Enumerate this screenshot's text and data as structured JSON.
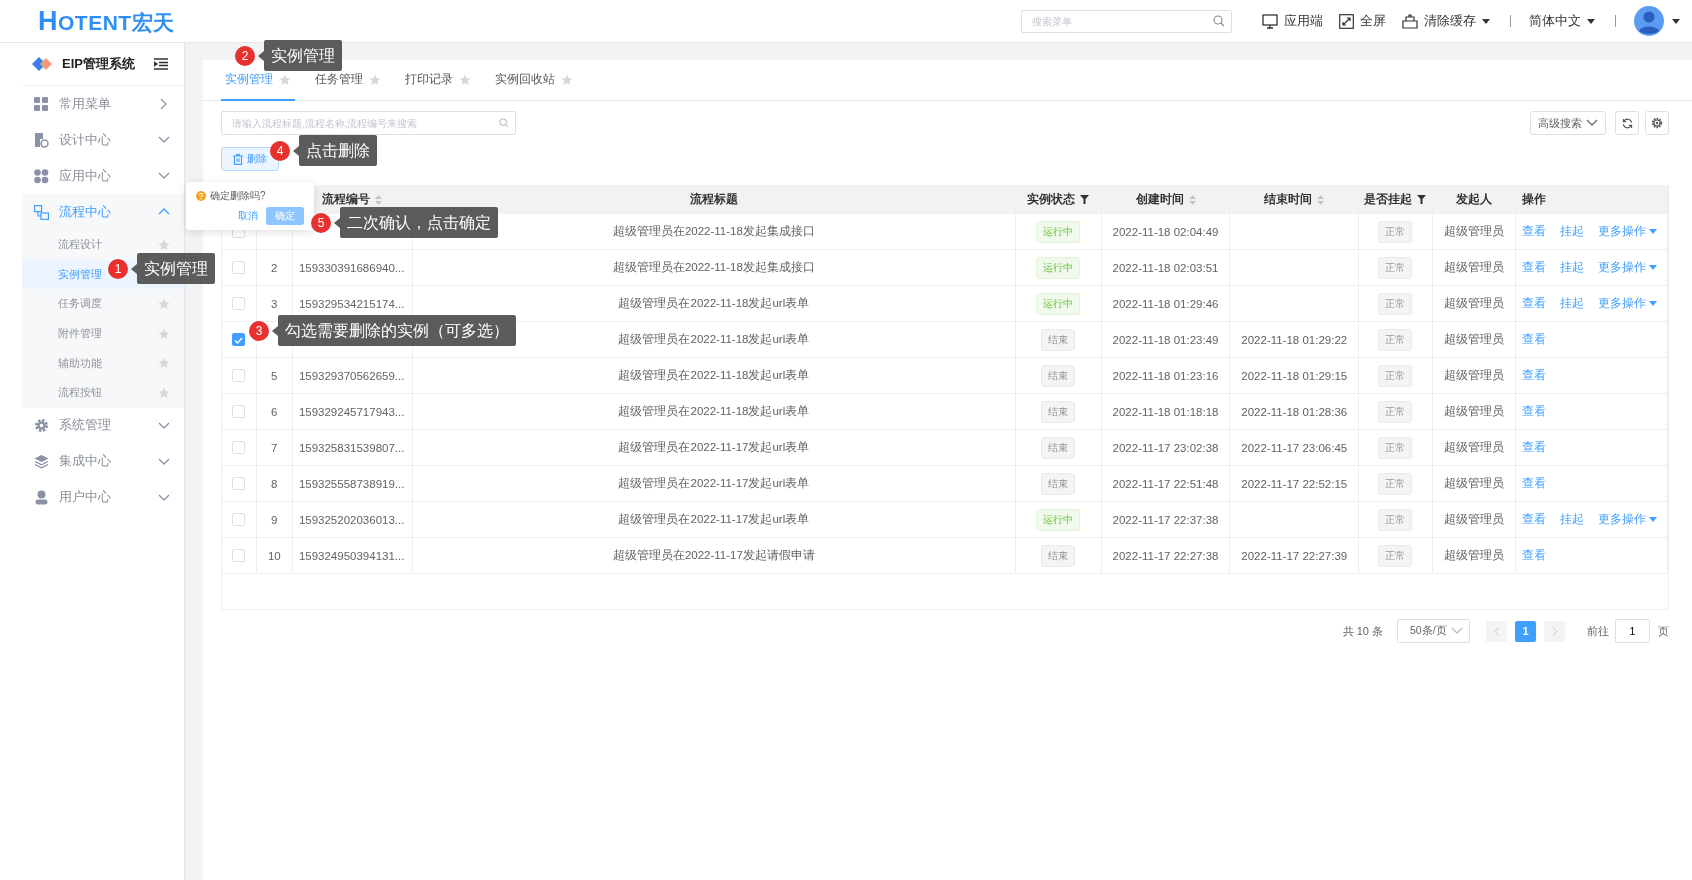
{
  "header": {
    "logo": "HOTENT宏天",
    "search": {
      "placeholder": "搜索菜单"
    },
    "actions": [
      {
        "label": "应用端",
        "dropdown": false
      },
      {
        "label": "全屏",
        "dropdown": false
      },
      {
        "label": "清除缓存",
        "dropdown": true
      }
    ],
    "language": {
      "label": "简体中文"
    }
  },
  "sidebar": {
    "title": "EIP管理系统",
    "items": [
      {
        "label": "常用菜单",
        "kind": "link",
        "selected": false
      },
      {
        "label": "设计中心",
        "kind": "group",
        "expanded": false,
        "selected": false
      },
      {
        "label": "应用中心",
        "kind": "group",
        "expanded": false,
        "selected": false
      },
      {
        "label": "流程中心",
        "kind": "group",
        "expanded": true,
        "selected": true,
        "children": [
          {
            "label": "流程设计",
            "selected": false
          },
          {
            "label": "实例管理",
            "selected": true
          },
          {
            "label": "任务调度",
            "selected": false
          },
          {
            "label": "附件管理",
            "selected": false
          },
          {
            "label": "辅助功能",
            "selected": false
          },
          {
            "label": "流程按钮",
            "selected": false
          }
        ]
      },
      {
        "label": "系统管理",
        "kind": "group",
        "expanded": false,
        "selected": false
      },
      {
        "label": "集成中心",
        "kind": "group",
        "expanded": false,
        "selected": false
      },
      {
        "label": "用户中心",
        "kind": "group",
        "expanded": false,
        "selected": false
      }
    ]
  },
  "tabs": [
    {
      "label": "实例管理",
      "selected": true
    },
    {
      "label": "任务管理",
      "selected": false
    },
    {
      "label": "打印记录",
      "selected": false
    },
    {
      "label": "实例回收站",
      "selected": false
    }
  ],
  "search": {
    "placeholder": "请输入流程标题,流程名称,流程编号来搜索"
  },
  "delete_button": "删除",
  "advanced_search": "高级搜索",
  "table": {
    "columns": [
      {
        "label": "流程编号",
        "sortable": true,
        "filterable": false
      },
      {
        "label": "流程标题",
        "sortable": false,
        "filterable": false
      },
      {
        "label": "实例状态",
        "sortable": false,
        "filterable": true
      },
      {
        "label": "创建时间",
        "sortable": true,
        "filterable": false
      },
      {
        "label": "结束时间",
        "sortable": true,
        "filterable": false
      },
      {
        "label": "是否挂起",
        "sortable": false,
        "filterable": true
      },
      {
        "label": "发起人",
        "sortable": false,
        "filterable": false
      },
      {
        "label": "操作",
        "sortable": false,
        "filterable": false
      }
    ],
    "rows": [
      {
        "checked": false,
        "title": "超级管理员在2022-11-18发起集成接口",
        "status": {
          "label": "运行中",
          "kind": "running"
        },
        "created": "2022-11-18 02:04:49",
        "suspended": "正常",
        "initiator": "超级管理员",
        "actions": [
          "查看",
          "挂起",
          "更多操作"
        ]
      },
      {
        "checked": false,
        "no": "2",
        "id": "159330391686940...",
        "title": "超级管理员在2022-11-18发起集成接口",
        "status": {
          "label": "运行中",
          "kind": "running"
        },
        "created": "2022-11-18 02:03:51",
        "suspended": "正常",
        "initiator": "超级管理员",
        "actions": [
          "查看",
          "挂起",
          "更多操作"
        ]
      },
      {
        "checked": false,
        "no": "3",
        "id": "159329534215174...",
        "title": "超级管理员在2022-11-18发起url表单",
        "status": {
          "label": "运行中",
          "kind": "running"
        },
        "created": "2022-11-18 01:29:46",
        "suspended": "正常",
        "initiator": "超级管理员",
        "actions": [
          "查看",
          "挂起",
          "更多操作"
        ]
      },
      {
        "checked": true,
        "title": "超级管理员在2022-11-18发起url表单",
        "status": {
          "label": "结束",
          "kind": "ended"
        },
        "created": "2022-11-18 01:23:49",
        "ended": "2022-11-18 01:29:22",
        "suspended": "正常",
        "initiator": "超级管理员",
        "actions": [
          "查看"
        ]
      },
      {
        "checked": false,
        "no": "5",
        "id": "159329370562659...",
        "title": "超级管理员在2022-11-18发起url表单",
        "status": {
          "label": "结束",
          "kind": "ended"
        },
        "created": "2022-11-18 01:23:16",
        "ended": "2022-11-18 01:29:15",
        "suspended": "正常",
        "initiator": "超级管理员",
        "actions": [
          "查看"
        ]
      },
      {
        "checked": false,
        "no": "6",
        "id": "159329245717943...",
        "title": "超级管理员在2022-11-18发起url表单",
        "status": {
          "label": "结束",
          "kind": "ended"
        },
        "created": "2022-11-18 01:18:18",
        "ended": "2022-11-18 01:28:36",
        "suspended": "正常",
        "initiator": "超级管理员",
        "actions": [
          "查看"
        ]
      },
      {
        "checked": false,
        "no": "7",
        "id": "159325831539807...",
        "title": "超级管理员在2022-11-17发起url表单",
        "status": {
          "label": "结束",
          "kind": "ended"
        },
        "created": "2022-11-17 23:02:38",
        "ended": "2022-11-17 23:06:45",
        "suspended": "正常",
        "initiator": "超级管理员",
        "actions": [
          "查看"
        ]
      },
      {
        "checked": false,
        "no": "8",
        "id": "159325558738919...",
        "title": "超级管理员在2022-11-17发起url表单",
        "status": {
          "label": "结束",
          "kind": "ended"
        },
        "created": "2022-11-17 22:51:48",
        "ended": "2022-11-17 22:52:15",
        "suspended": "正常",
        "initiator": "超级管理员",
        "actions": [
          "查看"
        ]
      },
      {
        "checked": false,
        "no": "9",
        "id": "159325202036013...",
        "title": "超级管理员在2022-11-17发起url表单",
        "status": {
          "label": "运行中",
          "kind": "running"
        },
        "created": "2022-11-17 22:37:38",
        "suspended": "正常",
        "initiator": "超级管理员",
        "actions": [
          "查看",
          "挂起",
          "更多操作"
        ]
      },
      {
        "checked": false,
        "no": "10",
        "id": "159324950394131...",
        "title": "超级管理员在2022-11-17发起请假申请",
        "status": {
          "label": "结束",
          "kind": "ended"
        },
        "created": "2022-11-17 22:27:38",
        "ended": "2022-11-17 22:27:39",
        "suspended": "正常",
        "initiator": "超级管理员",
        "actions": [
          "查看"
        ]
      }
    ]
  },
  "pagination": {
    "total": "共 10 条",
    "page_size": "50条/页",
    "pages": [
      {
        "label": "1",
        "selected": true
      }
    ],
    "goto_label": "前往",
    "goto_value": "1",
    "goto_suffix": "页"
  },
  "popover": {
    "message": "确定删除吗?",
    "cancel": "取消",
    "confirm": "确定"
  },
  "annotations": [
    {
      "number": "2",
      "text": "实例管理"
    },
    {
      "number": "4",
      "text": "点击删除"
    },
    {
      "number": "5",
      "text": "二次确认，点击确定"
    },
    {
      "number": "1",
      "text": "实例管理"
    },
    {
      "number": "3",
      "text": "勾选需要删除的实例（可多选）"
    }
  ]
}
